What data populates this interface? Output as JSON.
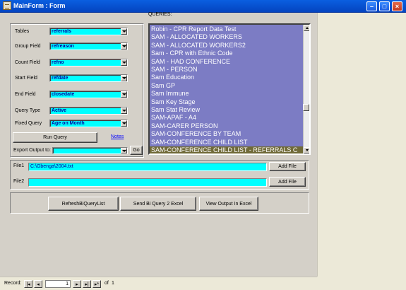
{
  "window": {
    "title": "MainForm : Form"
  },
  "fields": {
    "tables": {
      "label": "Tables",
      "value": "referrals"
    },
    "group_field": {
      "label": "Group Field",
      "value": "refreason"
    },
    "count_field": {
      "label": "Count Field",
      "value": "refno"
    },
    "start_field": {
      "label": "Start Field",
      "value": "refdate"
    },
    "end_field": {
      "label": "End Field",
      "value": "closedate"
    },
    "query_type": {
      "label": "Query Type",
      "value": "Active"
    },
    "fixed_query": {
      "label": "Fixed Query",
      "value": "Age on Month"
    }
  },
  "buttons": {
    "run_query": "Run Query",
    "notes_link": "Notes",
    "go": "Go",
    "add_file_1": "Add File",
    "add_file_2": "Add File",
    "refresh": "RefreshBiQueryList",
    "send_excel": "Send Bi Query 2 Excel",
    "view_output": "View Output In Excel"
  },
  "export": {
    "label": "Export Output to:",
    "value": ""
  },
  "queries": {
    "label": "QUERIES:",
    "items": [
      "Robin - CPR Report Data Test",
      "SAM - ALLOCATED WORKERS",
      "SAM - ALLOCATED WORKERS2",
      "Sam - CPR with Ethnic Code",
      "SAM - HAD CONFERENCE",
      "SAM - PERSON",
      "Sam Education",
      "Sam GP",
      "Sam Immune",
      "Sam Key Stage",
      "Sam Stat Review",
      "SAM-APAF - A4",
      "SAM-CARER PERSON",
      "SAM-CONFERENCE BY TEAM",
      "SAM-CONFERENCE CHILD LIST",
      "SAM-CONFERENCE CHILD LIST - REFERRALS C"
    ],
    "selected_index": 15
  },
  "files": {
    "file1": {
      "label": "File1",
      "value": "C:\\Gbenga\\2004.txt"
    },
    "file2": {
      "label": "File2",
      "value": ""
    }
  },
  "record_nav": {
    "label": "Record:",
    "current": "1",
    "of_label": "of",
    "total": "1"
  },
  "colors": {
    "field_bg": "#00FFFF",
    "list_bg": "#7C7CC4",
    "selected_bg": "#706A38",
    "form_bg": "#D4D0C8"
  },
  "icons": [
    "first-record-icon",
    "prev-record-icon",
    "next-record-icon",
    "last-record-icon",
    "new-record-icon"
  ]
}
